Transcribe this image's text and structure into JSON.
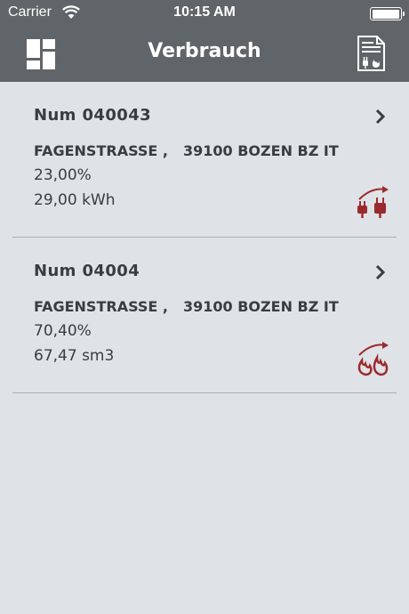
{
  "status_bar": {
    "carrier": "Carrier",
    "time": "10:15 AM",
    "battery_level": 1.0
  },
  "nav": {
    "title": "Verbrauch",
    "left_icon": "dashboard-grid-icon",
    "right_icon": "bill-document-icon"
  },
  "items": [
    {
      "title": "Num 040043",
      "street": "FAGENSTRASSE ,",
      "city": "39100 BOZEN BZ IT",
      "percent": "23,00%",
      "amount": "29,00 kWh",
      "icon": "electricity-plug-icon"
    },
    {
      "title": "Num 04004",
      "street": "FAGENSTRASSE ,",
      "city": "39100 BOZEN BZ IT",
      "percent": "70,40%",
      "amount": "67,47 sm3",
      "icon": "gas-flame-icon"
    }
  ],
  "colors": {
    "header": "#5f6568",
    "background": "#dfe2e6",
    "accent_icon": "#9a2a2d",
    "text": "#3a3d40"
  }
}
